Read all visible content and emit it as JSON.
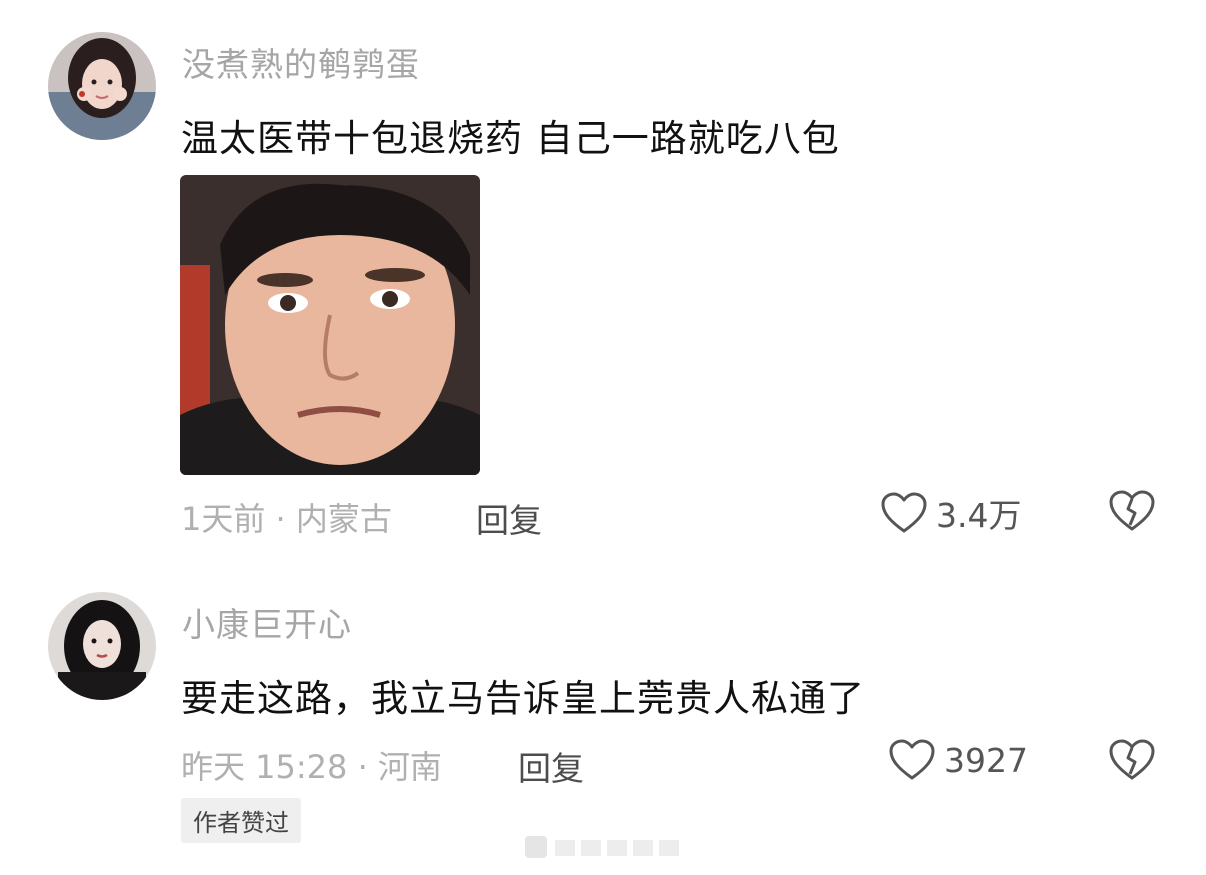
{
  "comments": [
    {
      "username": "没煮熟的鹌鹑蛋",
      "text": "温太医带十包退烧药 自己一路就吃八包",
      "meta": "1天前 · 内蒙古",
      "reply_label": "回复",
      "like_count": "3.4万",
      "avatar_icon": "avatar-girl-icon",
      "image_icon": "meme-face-image"
    },
    {
      "username": "小康巨开心",
      "text": "要走这路，我立马告诉皇上莞贵人私通了",
      "meta": "昨天 15:28 · 河南",
      "reply_label": "回复",
      "like_count": "3927",
      "badge": "作者赞过",
      "avatar_icon": "avatar-girl-icon"
    }
  ],
  "colors": {
    "username": "#a6a6a6",
    "meta": "#b0b0b0",
    "badge_bg": "#efefef"
  }
}
